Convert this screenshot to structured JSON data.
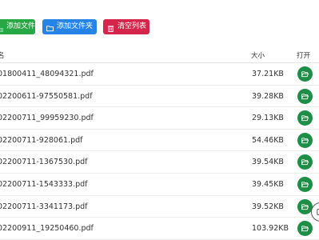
{
  "toolbar": {
    "add_file": "添加文件",
    "add_folder": "添加文件夹",
    "clear_list": "清空列表"
  },
  "table": {
    "headers": {
      "name": "名",
      "size": "大小",
      "open": "打开"
    },
    "rows": [
      {
        "name": "01800411_48094321.pdf",
        "size": "37.21KB"
      },
      {
        "name": "02200611-97550581.pdf",
        "size": "39.28KB"
      },
      {
        "name": "02200711_99959230.pdf",
        "size": "29.13KB"
      },
      {
        "name": "02200711-928061.pdf",
        "size": "54.46KB"
      },
      {
        "name": "02200711-1367530.pdf",
        "size": "39.54KB"
      },
      {
        "name": "02200711-1543333.pdf",
        "size": "39.45KB"
      },
      {
        "name": "02200711-3341173.pdf",
        "size": "39.52KB"
      },
      {
        "name": "02200911_19250460.pdf",
        "size": "103.92KB"
      }
    ]
  },
  "colors": {
    "add_file": "#28a745",
    "add_folder": "#2684e6",
    "clear_list": "#d4264a",
    "open_button": "#1e8e46"
  },
  "icons": {
    "add_file": "file-plus-icon",
    "add_folder": "folder-icon",
    "clear_list": "trash-icon",
    "open": "folder-open-icon",
    "floating": "floating-tool-icon"
  }
}
